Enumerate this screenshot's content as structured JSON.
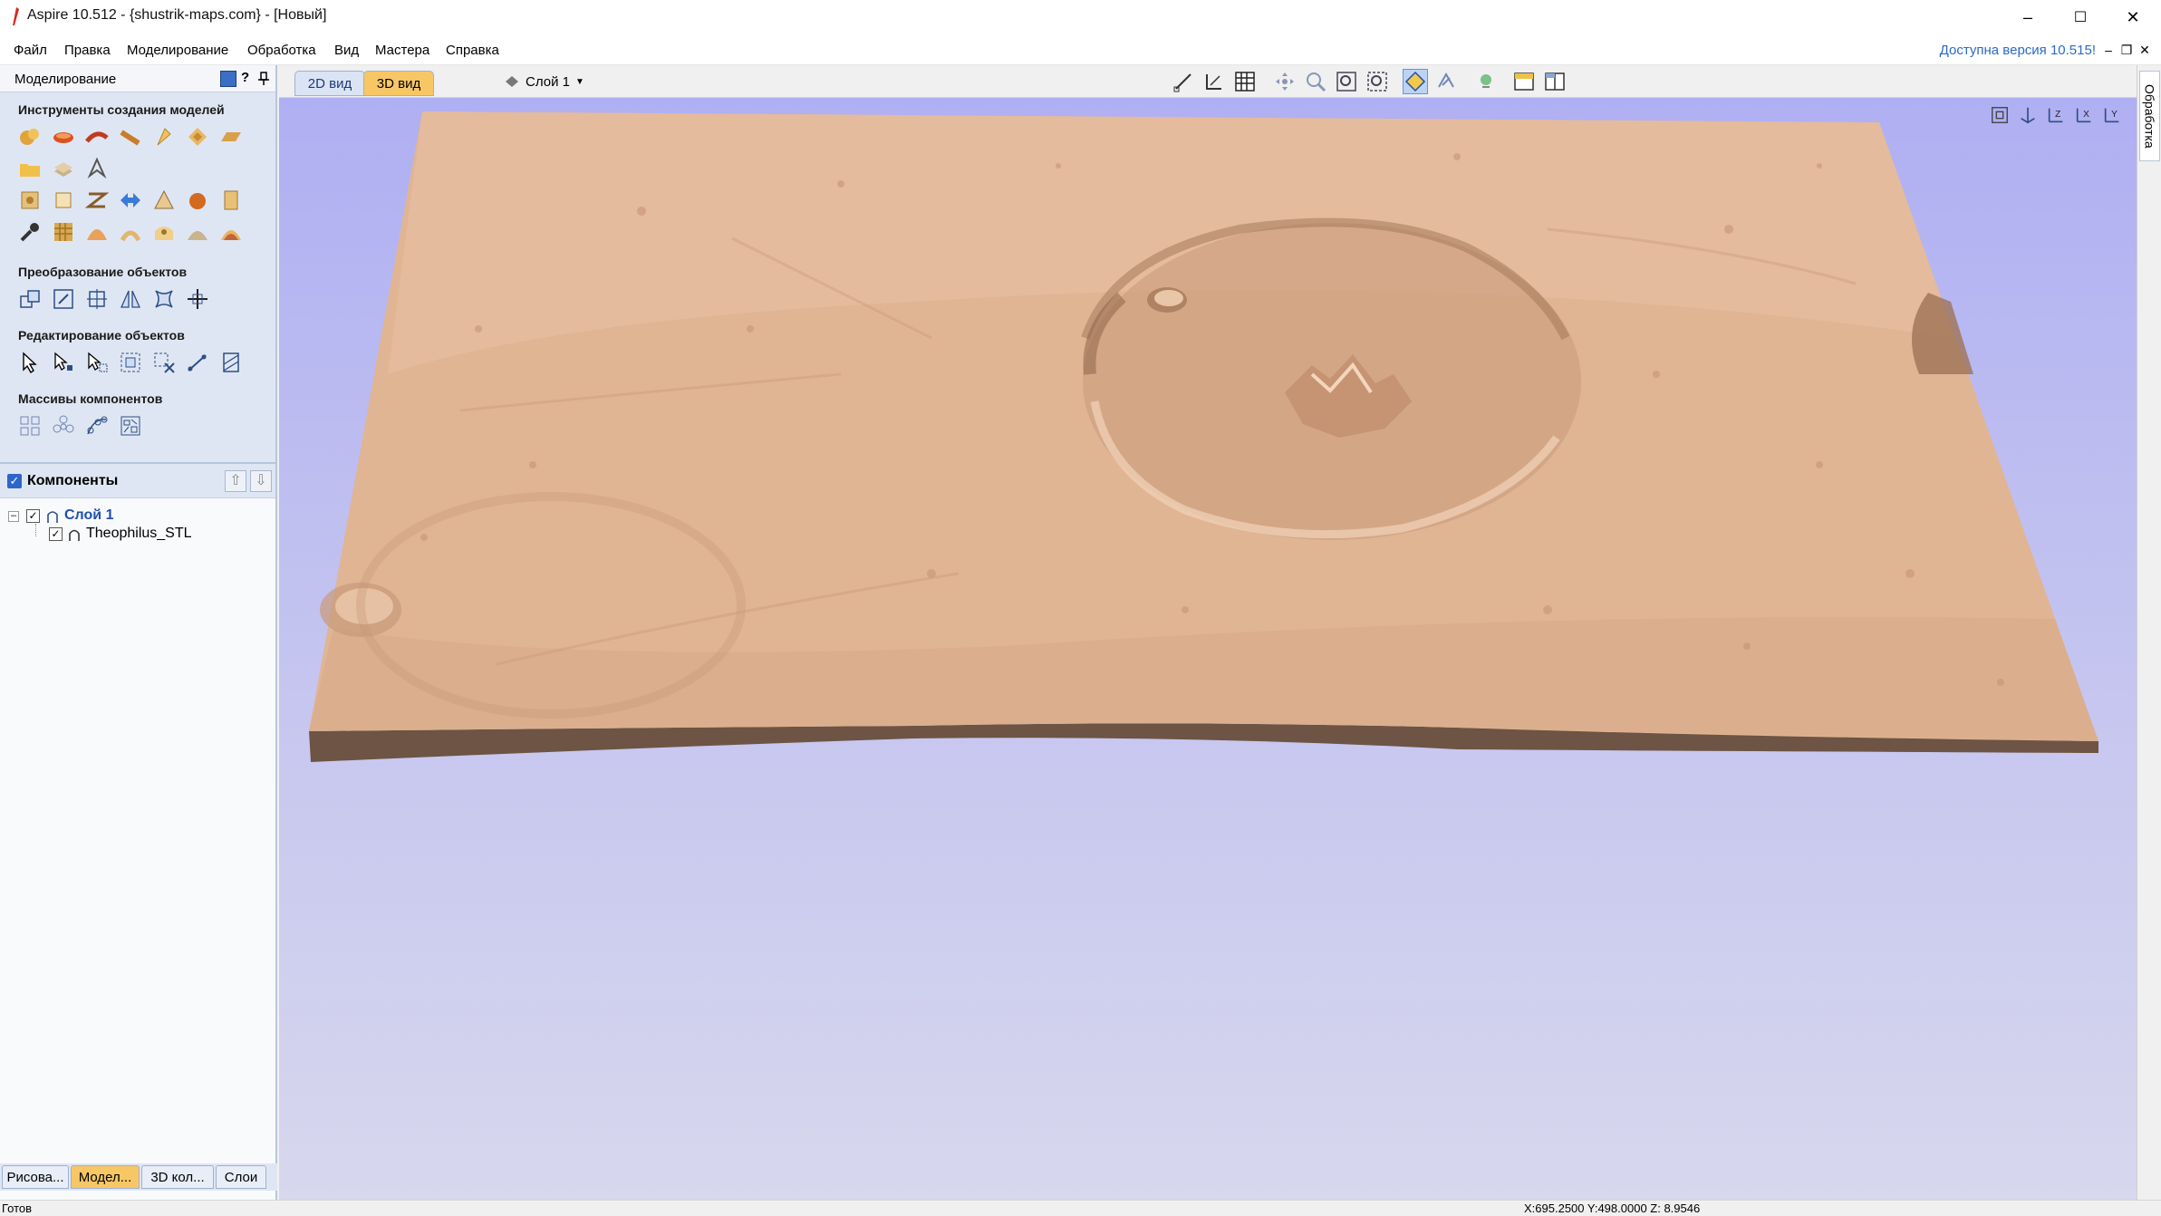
{
  "window": {
    "title": "Aspire 10.512 - {shustrik-maps.com} - [Новый]",
    "minimize_glyph": "–",
    "maximize_glyph": "☐",
    "close_glyph": "✕"
  },
  "menu": {
    "items": [
      "Файл",
      "Правка",
      "Моделирование",
      "Обработка",
      "Вид",
      "Мастера",
      "Справка"
    ],
    "update_notice": "Доступна версия 10.515!",
    "mdi_minimize": "–",
    "mdi_restore": "❐",
    "mdi_close": "✕"
  },
  "left_panel": {
    "title": "Моделирование",
    "header_icons": [
      "dock-icon",
      "help-icon",
      "pin-icon"
    ],
    "help_glyph": "?",
    "sections": [
      {
        "title": "Инструменты создания моделей"
      },
      {
        "title": "Преобразование объектов"
      },
      {
        "title": "Редактирование объектов"
      },
      {
        "title": "Массивы компонентов"
      }
    ],
    "components": {
      "title": "Компоненты",
      "tree": [
        {
          "label": "Слой 1",
          "checked": true,
          "expanded": true
        },
        {
          "label": "Theophilus_STL",
          "checked": true
        }
      ]
    },
    "bottom_tabs": [
      "Рисова...",
      "Модел...",
      "3D кол...",
      "Слои"
    ],
    "active_bottom_tab": 1
  },
  "view": {
    "tabs": [
      "2D вид",
      "3D вид"
    ],
    "active_tab": 1,
    "layer_selector": "Слой 1"
  },
  "right_tab": {
    "label": "Обработка"
  },
  "status": {
    "left": "Готов",
    "coords": "X:695.2500 Y:498.0000 Z:  8.9546"
  },
  "colors": {
    "terrain_top": "#e0b494",
    "terrain_side": "#6e5647",
    "viewport_top": "#afaff3",
    "viewport_bottom": "#d7d7ee",
    "active_tab": "#f7c766",
    "panel_bg": "#dfe6f3",
    "link": "#2a6ac7"
  }
}
